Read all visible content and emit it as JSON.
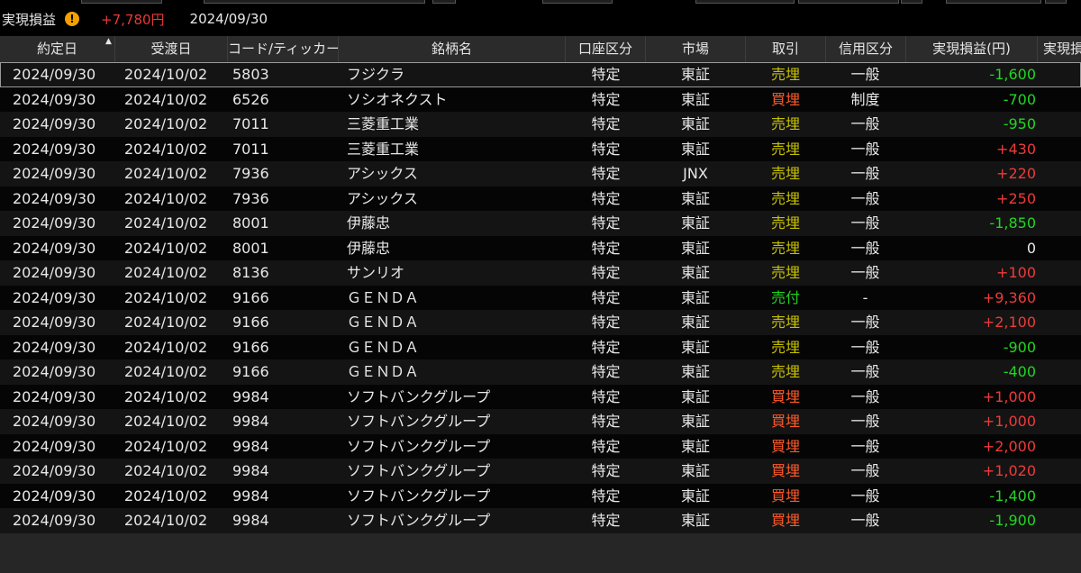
{
  "summary": {
    "label": "実現損益",
    "warning_icon": "exclamation-icon",
    "total_pl": "+7,780円",
    "date": "2024/09/30"
  },
  "table": {
    "headers": [
      "約定日",
      "受渡日",
      "コード/ティッカー",
      "銘柄名",
      "口座区分",
      "市場",
      "取引",
      "信用区分",
      "実現損益(円)",
      "実現損"
    ],
    "sort_indicator": "ascending",
    "rows": [
      {
        "date": "2024/09/30",
        "settle": "2024/10/02",
        "code": "5803",
        "name": "フジクラ",
        "account": "特定",
        "market": "東証",
        "trade": "売埋",
        "credit": "一般",
        "pl": "-1,600"
      },
      {
        "date": "2024/09/30",
        "settle": "2024/10/02",
        "code": "6526",
        "name": "ソシオネクスト",
        "account": "特定",
        "market": "東証",
        "trade": "買埋",
        "credit": "制度",
        "pl": "-700"
      },
      {
        "date": "2024/09/30",
        "settle": "2024/10/02",
        "code": "7011",
        "name": "三菱重工業",
        "account": "特定",
        "market": "東証",
        "trade": "売埋",
        "credit": "一般",
        "pl": "-950"
      },
      {
        "date": "2024/09/30",
        "settle": "2024/10/02",
        "code": "7011",
        "name": "三菱重工業",
        "account": "特定",
        "market": "東証",
        "trade": "売埋",
        "credit": "一般",
        "pl": "+430"
      },
      {
        "date": "2024/09/30",
        "settle": "2024/10/02",
        "code": "7936",
        "name": "アシックス",
        "account": "特定",
        "market": "JNX",
        "trade": "売埋",
        "credit": "一般",
        "pl": "+220"
      },
      {
        "date": "2024/09/30",
        "settle": "2024/10/02",
        "code": "7936",
        "name": "アシックス",
        "account": "特定",
        "market": "東証",
        "trade": "売埋",
        "credit": "一般",
        "pl": "+250"
      },
      {
        "date": "2024/09/30",
        "settle": "2024/10/02",
        "code": "8001",
        "name": "伊藤忠",
        "account": "特定",
        "market": "東証",
        "trade": "売埋",
        "credit": "一般",
        "pl": "-1,850"
      },
      {
        "date": "2024/09/30",
        "settle": "2024/10/02",
        "code": "8001",
        "name": "伊藤忠",
        "account": "特定",
        "market": "東証",
        "trade": "売埋",
        "credit": "一般",
        "pl": "0"
      },
      {
        "date": "2024/09/30",
        "settle": "2024/10/02",
        "code": "8136",
        "name": "サンリオ",
        "account": "特定",
        "market": "東証",
        "trade": "売埋",
        "credit": "一般",
        "pl": "+100"
      },
      {
        "date": "2024/09/30",
        "settle": "2024/10/02",
        "code": "9166",
        "name": "ＧＥＮＤＡ",
        "account": "特定",
        "market": "東証",
        "trade": "売付",
        "credit": "-",
        "pl": "+9,360"
      },
      {
        "date": "2024/09/30",
        "settle": "2024/10/02",
        "code": "9166",
        "name": "ＧＥＮＤＡ",
        "account": "特定",
        "market": "東証",
        "trade": "売埋",
        "credit": "一般",
        "pl": "+2,100"
      },
      {
        "date": "2024/09/30",
        "settle": "2024/10/02",
        "code": "9166",
        "name": "ＧＥＮＤＡ",
        "account": "特定",
        "market": "東証",
        "trade": "売埋",
        "credit": "一般",
        "pl": "-900"
      },
      {
        "date": "2024/09/30",
        "settle": "2024/10/02",
        "code": "9166",
        "name": "ＧＥＮＤＡ",
        "account": "特定",
        "market": "東証",
        "trade": "売埋",
        "credit": "一般",
        "pl": "-400"
      },
      {
        "date": "2024/09/30",
        "settle": "2024/10/02",
        "code": "9984",
        "name": "ソフトバンクグループ",
        "account": "特定",
        "market": "東証",
        "trade": "買埋",
        "credit": "一般",
        "pl": "+1,000"
      },
      {
        "date": "2024/09/30",
        "settle": "2024/10/02",
        "code": "9984",
        "name": "ソフトバンクグループ",
        "account": "特定",
        "market": "東証",
        "trade": "買埋",
        "credit": "一般",
        "pl": "+1,000"
      },
      {
        "date": "2024/09/30",
        "settle": "2024/10/02",
        "code": "9984",
        "name": "ソフトバンクグループ",
        "account": "特定",
        "market": "東証",
        "trade": "買埋",
        "credit": "一般",
        "pl": "+2,000"
      },
      {
        "date": "2024/09/30",
        "settle": "2024/10/02",
        "code": "9984",
        "name": "ソフトバンクグループ",
        "account": "特定",
        "market": "東証",
        "trade": "買埋",
        "credit": "一般",
        "pl": "+1,020"
      },
      {
        "date": "2024/09/30",
        "settle": "2024/10/02",
        "code": "9984",
        "name": "ソフトバンクグループ",
        "account": "特定",
        "market": "東証",
        "trade": "買埋",
        "credit": "一般",
        "pl": "-1,400"
      },
      {
        "date": "2024/09/30",
        "settle": "2024/10/02",
        "code": "9984",
        "name": "ソフトバンクグループ",
        "account": "特定",
        "market": "東証",
        "trade": "買埋",
        "credit": "一般",
        "pl": "-1,900"
      }
    ]
  },
  "colors": {
    "background": "#000000",
    "profit": "#ee3a3a",
    "loss": "#22d622",
    "sell_close": "#c6c000",
    "buy_close": "#ff5a2a",
    "sell_open": "#1fd41f",
    "warning": "#f5a000"
  }
}
